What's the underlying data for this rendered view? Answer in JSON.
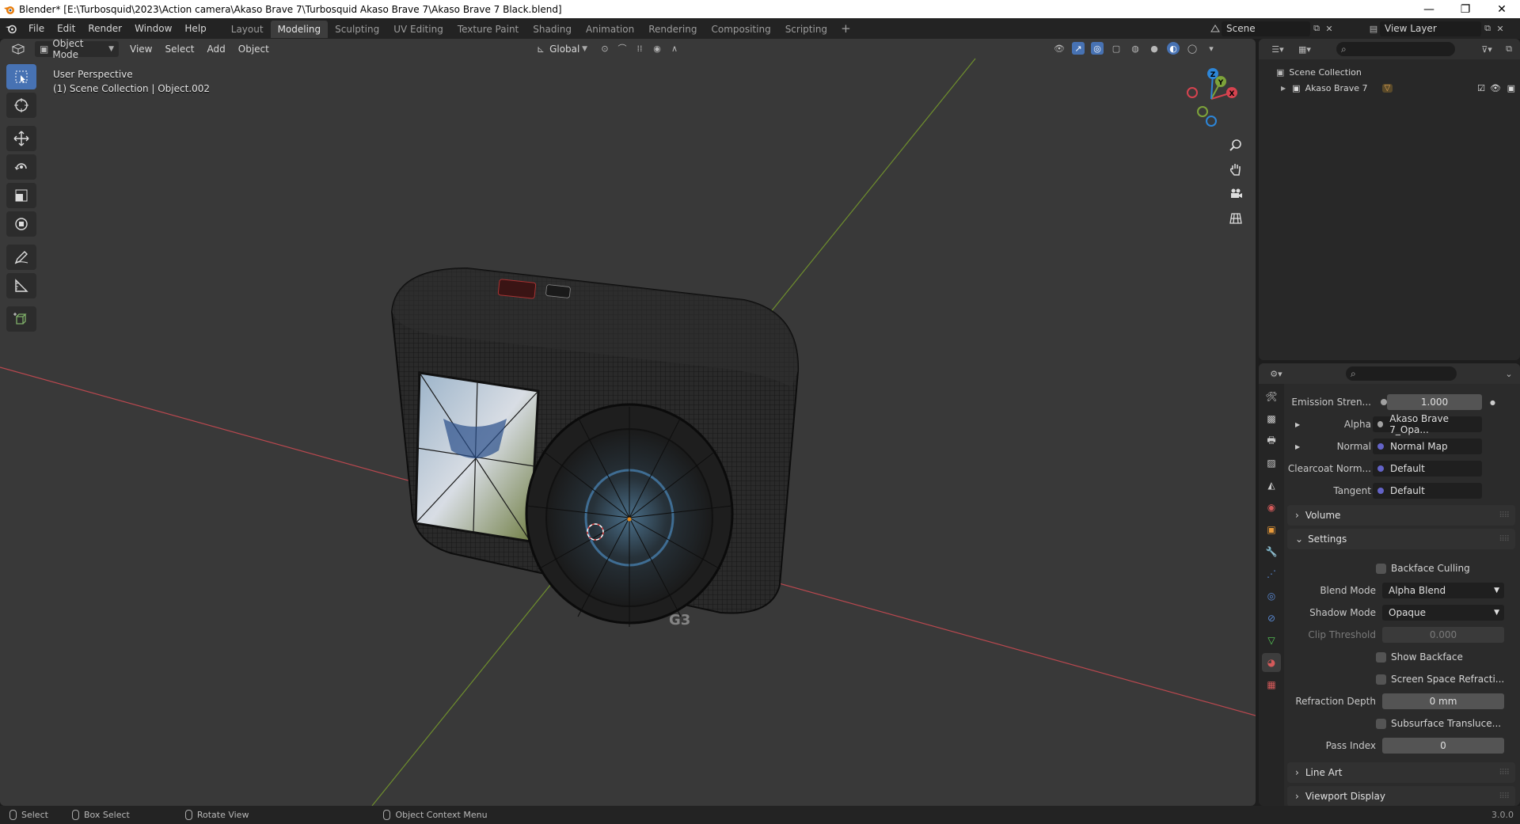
{
  "window": {
    "title": "Blender* [E:\\Turbosquid\\2023\\Action camera\\Akaso Brave 7\\Turbosquid Akaso Brave 7\\Akaso Brave 7 Black.blend]",
    "minimize": "—",
    "maximize": "❐",
    "close": "✕"
  },
  "menu": [
    "File",
    "Edit",
    "Render",
    "Window",
    "Help"
  ],
  "workspaces": [
    {
      "label": "Layout",
      "active": false
    },
    {
      "label": "Modeling",
      "active": true
    },
    {
      "label": "Sculpting",
      "active": false
    },
    {
      "label": "UV Editing",
      "active": false
    },
    {
      "label": "Texture Paint",
      "active": false
    },
    {
      "label": "Shading",
      "active": false
    },
    {
      "label": "Animation",
      "active": false
    },
    {
      "label": "Rendering",
      "active": false
    },
    {
      "label": "Compositing",
      "active": false
    },
    {
      "label": "Scripting",
      "active": false
    }
  ],
  "scene": {
    "label": "Scene"
  },
  "view_layer": {
    "label": "View Layer"
  },
  "viewport": {
    "mode": "Object Mode",
    "menus": [
      "View",
      "Select",
      "Add",
      "Object"
    ],
    "transform_orientation": "Global",
    "info_line1": "User Perspective",
    "info_line2": "(1) Scene Collection | Object.002",
    "gizmo": {
      "x": "X",
      "y": "Y",
      "z": "Z"
    }
  },
  "outliner": {
    "root": "Scene Collection",
    "items": [
      {
        "label": "Akaso Brave 7"
      }
    ]
  },
  "properties": {
    "emission_strength": {
      "label": "Emission Stren...",
      "value": "1.000"
    },
    "alpha": {
      "label": "Alpha",
      "value": "Akaso Brave 7_Opa..."
    },
    "normal": {
      "label": "Normal",
      "value": "Normal Map"
    },
    "clearcoat_normal": {
      "label": "Clearcoat Norm...",
      "value": "Default"
    },
    "tangent": {
      "label": "Tangent",
      "value": "Default"
    },
    "panels": {
      "volume": "Volume",
      "settings": "Settings",
      "line_art": "Line Art",
      "viewport_display": "Viewport Display"
    },
    "backface_culling": "Backface Culling",
    "blend_mode": {
      "label": "Blend Mode",
      "value": "Alpha Blend"
    },
    "shadow_mode": {
      "label": "Shadow Mode",
      "value": "Opaque"
    },
    "clip_threshold": {
      "label": "Clip Threshold",
      "value": "0.000"
    },
    "show_backface": "Show Backface",
    "screen_space_refraction": "Screen Space Refracti...",
    "refraction_depth": {
      "label": "Refraction Depth",
      "value": "0 mm"
    },
    "subsurface_translucency": "Subsurface Transluce...",
    "pass_index": {
      "label": "Pass Index",
      "value": "0"
    }
  },
  "statusbar": {
    "select": "Select",
    "box_select": "Box Select",
    "rotate_view": "Rotate View",
    "context_menu": "Object Context Menu",
    "version": "3.0.0"
  },
  "colors": {
    "accent": "#4772b3",
    "x_axis": "#d6434f",
    "y_axis": "#7da33a",
    "z_axis": "#2d86d8"
  }
}
